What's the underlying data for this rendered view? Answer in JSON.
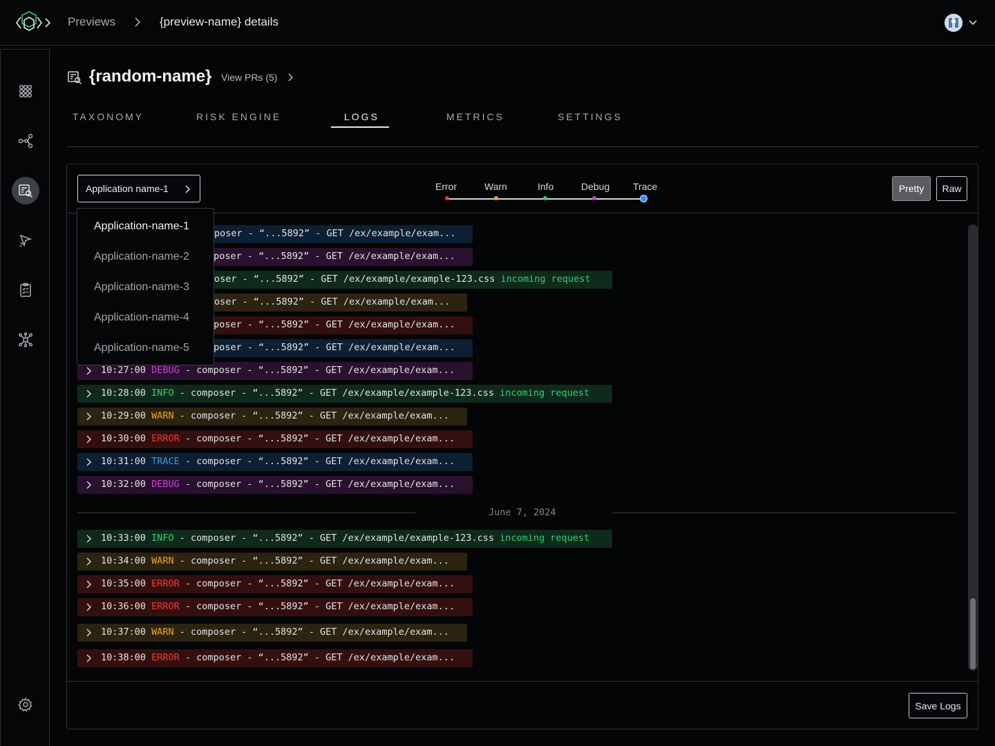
{
  "header": {
    "breadcrumb_root": "Previews",
    "breadcrumb_current": "{preview-name} details"
  },
  "page": {
    "title": "{random-name}",
    "view_prs": "View PRs (5)"
  },
  "tabs": [
    {
      "label": "TAXONOMY"
    },
    {
      "label": "RISK ENGINE"
    },
    {
      "label": "LOGS",
      "active": true
    },
    {
      "label": "METRICS"
    },
    {
      "label": "SETTINGS"
    }
  ],
  "logs": {
    "app_select": "Application name-1",
    "dropdown": [
      "Application-name-1",
      "Application-name-2",
      "Application-name-3",
      "Application-name-4",
      "Application-name-5"
    ],
    "levels": [
      "Error",
      "Warn",
      "Info",
      "Debug",
      "Trace"
    ],
    "selected_level": "Trace",
    "level_colors": {
      "error": "#f0372d",
      "warn": "#f2a623",
      "info": "#2fd17a",
      "debug": "#c743d9",
      "trace": "#3e9bf0"
    },
    "view_modes": [
      "Pretty",
      "Raw"
    ],
    "active_view": "Pretty",
    "rows_partial": [
      {
        "level": "trace",
        "rest": "poser - “...5892” - GET /ex/example/exam..."
      },
      {
        "level": "debug",
        "rest": "mposer - “...5892” - GET /ex/example/exam..."
      },
      {
        "level": "info",
        "rest": "oser - “...5892” - GET /ex/example/example-123.css",
        "extra": "incoming request"
      },
      {
        "level": "warn",
        "rest": "oser - “...5892” - GET /ex/example/exam..."
      },
      {
        "level": "error",
        "rest": "mposer - “...5892” - GET /ex/example/exam..."
      },
      {
        "level": "trace",
        "rest": "mposer - “...5892” - GET /ex/example/exam..."
      }
    ],
    "rows": [
      {
        "time": "10:27:00",
        "level": "DEBUG",
        "rest": " - composer - “...5892” - GET /ex/example/exam..."
      },
      {
        "time": "10:28:00",
        "level": "INFO",
        "rest": " - composer - “...5892” - GET /ex/example/example-123.css ",
        "extra": "incoming request"
      },
      {
        "time": "10:29:00",
        "level": "WARN",
        "rest": " - composer - “...5892” - GET /ex/example/exam..."
      },
      {
        "time": "10:30:00",
        "level": "ERROR",
        "rest": " - composer - “...5892” - GET /ex/example/exam..."
      },
      {
        "time": "10:31:00",
        "level": "TRACE",
        "rest": " - composer - “...5892” - GET /ex/example/exam..."
      },
      {
        "time": "10:32:00",
        "level": "DEBUG",
        "rest": " - composer - “...5892” - GET /ex/example/exam..."
      }
    ],
    "date_separator": "June 7, 2024",
    "rows_after": [
      {
        "time": "10:33:00",
        "level": "INFO",
        "rest": " - composer - “...5892” - GET /ex/example/example-123.css ",
        "extra": "incoming request"
      },
      {
        "time": "10:34:00",
        "level": "WARN",
        "rest": " - composer - “...5892” - GET /ex/example/exam..."
      },
      {
        "time": "10:35:00",
        "level": "ERROR",
        "rest": " - composer - “...5892” - GET /ex/example/exam..."
      },
      {
        "time": "10:36:00",
        "level": "ERROR",
        "rest": " - composer - “...5892” - GET /ex/example/exam..."
      },
      {
        "time": "10:37:00",
        "level": "WARN",
        "rest": " - composer - “...5892” - GET /ex/example/exam..."
      },
      {
        "time": "10:38:00",
        "level": "ERROR",
        "rest": " - composer - “...5892” - GET /ex/example/exam..."
      }
    ],
    "save_label": "Save Logs"
  },
  "icons": {
    "logo": "logo-icon",
    "sidebar": [
      "taxonomy-icon",
      "graph-icon",
      "previews-icon",
      "deploy-icon",
      "checklist-icon",
      "network-icon",
      "settings-icon"
    ]
  }
}
